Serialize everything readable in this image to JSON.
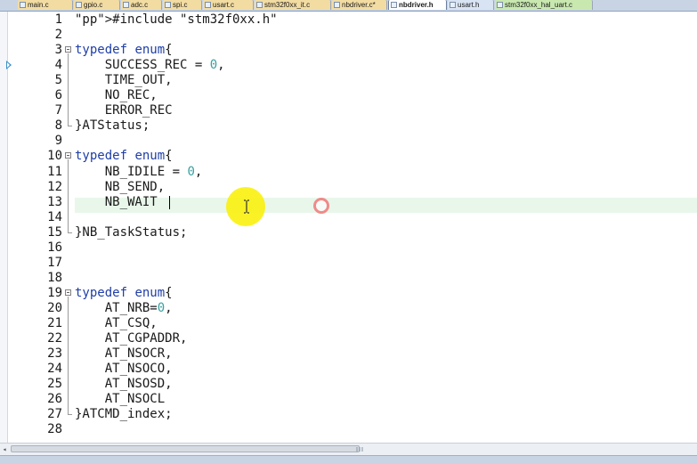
{
  "tabs": [
    {
      "label": "main.c",
      "type": "c",
      "active": false
    },
    {
      "label": "gpio.c",
      "type": "c",
      "active": false
    },
    {
      "label": "adc.c",
      "type": "c",
      "active": false
    },
    {
      "label": "spi.c",
      "type": "c",
      "active": false
    },
    {
      "label": "usart.c",
      "type": "c",
      "active": false
    },
    {
      "label": "stm32f0xx_it.c",
      "type": "c",
      "active": false
    },
    {
      "label": "nbdriver.c*",
      "type": "c",
      "active": false
    },
    {
      "label": "nbdriver.h",
      "type": "h",
      "active": true
    },
    {
      "label": "usart.h",
      "type": "h",
      "active": false
    },
    {
      "label": "stm32f0xx_hal_uart.c",
      "type": "c",
      "active": false
    }
  ],
  "editor": {
    "current_line": 13,
    "lines": [
      {
        "n": "1",
        "text": "#include \"stm32f0xx.h\""
      },
      {
        "n": "2",
        "text": ""
      },
      {
        "n": "3",
        "text": "typedef enum{"
      },
      {
        "n": "4",
        "text": "    SUCCESS_REC = 0,"
      },
      {
        "n": "5",
        "text": "    TIME_OUT,"
      },
      {
        "n": "6",
        "text": "    NO_REC,"
      },
      {
        "n": "7",
        "text": "    ERROR_REC"
      },
      {
        "n": "8",
        "text": "}ATStatus;"
      },
      {
        "n": "9",
        "text": ""
      },
      {
        "n": "10",
        "text": "typedef enum{"
      },
      {
        "n": "11",
        "text": "    NB_IDILE = 0,"
      },
      {
        "n": "12",
        "text": "    NB_SEND,"
      },
      {
        "n": "13",
        "text": "    NB_WAIT"
      },
      {
        "n": "14",
        "text": ""
      },
      {
        "n": "15",
        "text": "}NB_TaskStatus;"
      },
      {
        "n": "16",
        "text": ""
      },
      {
        "n": "17",
        "text": ""
      },
      {
        "n": "18",
        "text": ""
      },
      {
        "n": "19",
        "text": "typedef enum{"
      },
      {
        "n": "20",
        "text": "    AT_NRB=0,"
      },
      {
        "n": "21",
        "text": "    AT_CSQ,"
      },
      {
        "n": "22",
        "text": "    AT_CGPADDR,"
      },
      {
        "n": "23",
        "text": "    AT_NSOCR,"
      },
      {
        "n": "24",
        "text": "    AT_NSOCO,"
      },
      {
        "n": "25",
        "text": "    AT_NSOSD,"
      },
      {
        "n": "26",
        "text": "    AT_NSOCL"
      },
      {
        "n": "27",
        "text": "}ATCMD_index;"
      },
      {
        "n": "28",
        "text": ""
      }
    ]
  },
  "colors": {
    "keyword": "#1f3fa8",
    "preprocessor": "#7a4a2a",
    "number": "#3aa0a0",
    "current_line": "#e8f7ea",
    "cursor_highlight": "#faf000",
    "click_indicator": "#f08a8a"
  },
  "icons": {
    "bookmark": "current-position-arrow-icon",
    "fold": "fold-collapse-icon",
    "cursor": "ibeam-cursor-icon"
  }
}
